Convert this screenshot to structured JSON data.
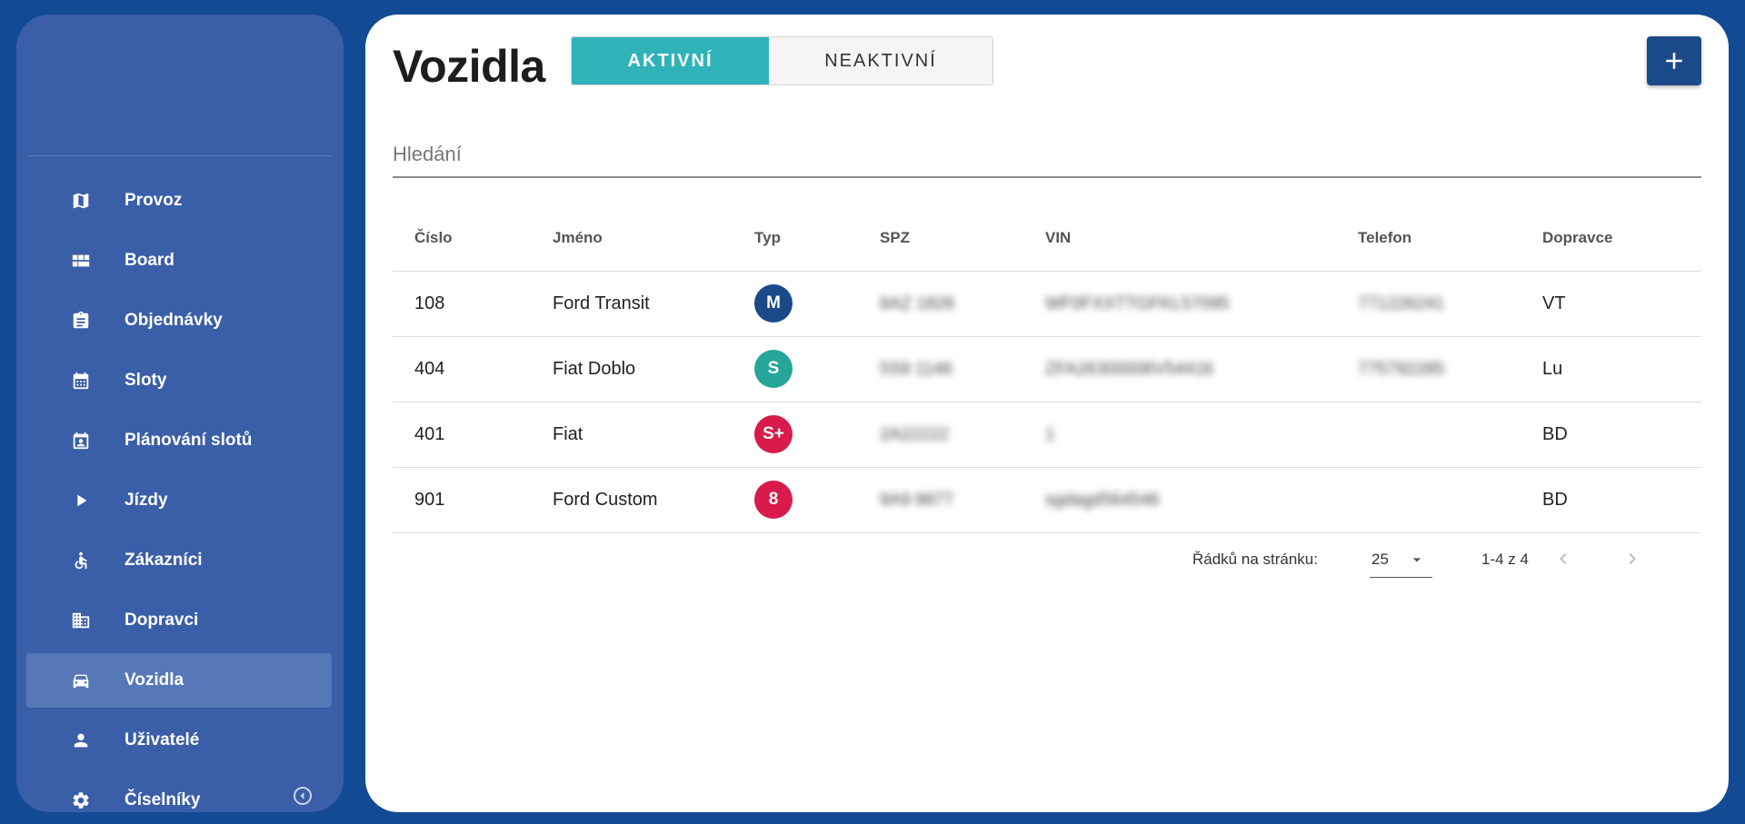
{
  "sidebar": {
    "items": [
      {
        "label": "Provoz",
        "icon": "map-icon"
      },
      {
        "label": "Board",
        "icon": "dashboard-icon"
      },
      {
        "label": "Objednávky",
        "icon": "clipboard-icon"
      },
      {
        "label": "Sloty",
        "icon": "calendar-icon"
      },
      {
        "label": "Plánování slotů",
        "icon": "calendar-user-icon"
      },
      {
        "label": "Jízdy",
        "icon": "play-icon"
      },
      {
        "label": "Zákazníci",
        "icon": "accessible-icon"
      },
      {
        "label": "Dopravci",
        "icon": "building-icon"
      },
      {
        "label": "Vozidla",
        "icon": "car-icon",
        "active": true
      },
      {
        "label": "Uživatelé",
        "icon": "person-icon"
      },
      {
        "label": "Číselníky",
        "icon": "gear-icon"
      }
    ]
  },
  "header": {
    "title": "Vozidla",
    "tabs": [
      {
        "label": "AKTIVNÍ",
        "active": true
      },
      {
        "label": "NEAKTIVNÍ",
        "active": false
      }
    ]
  },
  "search": {
    "placeholder": "Hledání"
  },
  "table": {
    "columns": [
      "Číslo",
      "Jméno",
      "Typ",
      "SPZ",
      "VIN",
      "Telefon",
      "Dopravce"
    ],
    "rows": [
      {
        "cislo": "108",
        "jmeno": "Ford Transit",
        "typ": "M",
        "typ_color": "#1a4a8a",
        "spz": "8AZ 1826",
        "vin": "WF0FXXTTGFKL57095",
        "telefon": "771226241",
        "dopravce": "VT"
      },
      {
        "cislo": "404",
        "jmeno": "Fiat Doblo",
        "typ": "S",
        "typ_color": "#26a69a",
        "spz": "5S9 1146",
        "vin": "ZFA26300006V54416",
        "telefon": "775792285",
        "dopravce": "Lu"
      },
      {
        "cislo": "401",
        "jmeno": "Fiat",
        "typ": "S+",
        "typ_color": "#d81b4a",
        "spz": "2A22222",
        "vin": "1",
        "telefon": "",
        "dopravce": "BD"
      },
      {
        "cislo": "901",
        "jmeno": "Ford Custom",
        "typ": "8",
        "typ_color": "#d81b4a",
        "spz": "9A9 8877",
        "vin": "sgdagd564546",
        "telefon": "",
        "dopravce": "BD"
      }
    ]
  },
  "pager": {
    "rows_label": "Řádků na stránku:",
    "rows_value": "25",
    "range": "1-4 z 4"
  },
  "colors": {
    "background": "#134a94",
    "sidebar": "#3a5fa8",
    "accent_teal": "#2fb3b9",
    "primary": "#1a4a8a"
  }
}
